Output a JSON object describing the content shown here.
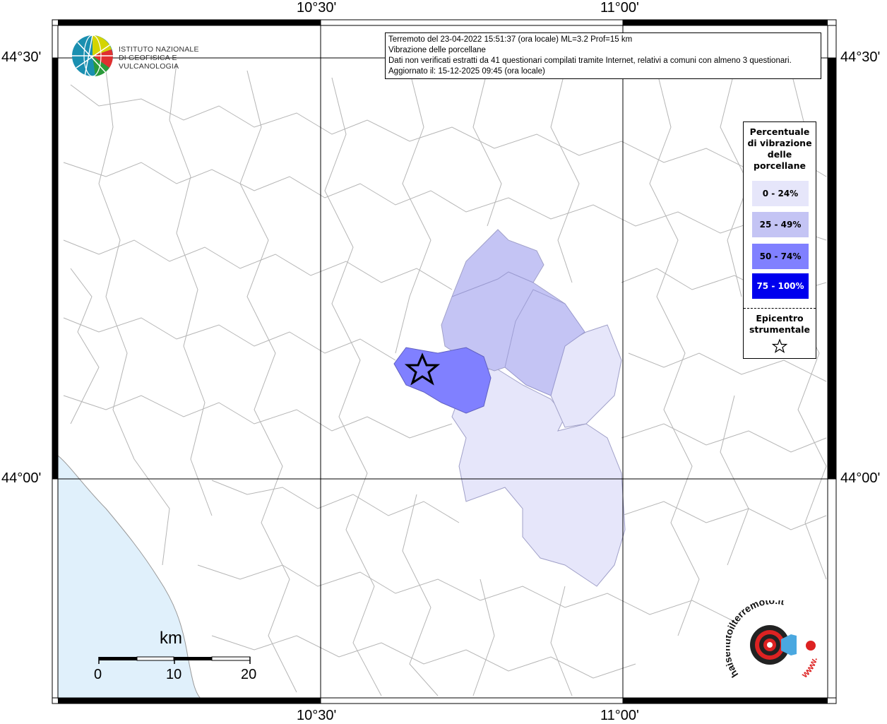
{
  "info": {
    "line1": "Terremoto del 23-04-2022 15:51:37 (ora locale) ML=3.2 Prof=15 km",
    "line2": "Vibrazione delle porcellane",
    "line3": "Dati non verificati estratti da 41 questionari compilati tramite Internet, relativi a comuni con almeno 3 questionari.",
    "line4": "Aggiornato il: 15-12-2025 09:45 (ora locale)"
  },
  "axes": {
    "top_left": "10°30'",
    "top_right": "11°00'",
    "bottom_left": "10°30'",
    "bottom_right": "11°00'",
    "left_top": "44°30'",
    "left_bottom": "44°00'",
    "right_top": "44°30'",
    "right_bottom": "44°00'"
  },
  "logo": {
    "line1": "ISTITUTO NAZIONALE",
    "line2": "DI GEOFISICA E VULCANOLOGIA"
  },
  "legend": {
    "title_lines": [
      "Percentuale",
      "di vibrazione",
      "delle",
      "porcellane"
    ],
    "items": [
      {
        "label": "0 - 24%",
        "color": "#e6e6fa",
        "text_color": "#000000"
      },
      {
        "label": "25 - 49%",
        "color": "#c4c4f4",
        "text_color": "#000000"
      },
      {
        "label": "50 - 74%",
        "color": "#8080ff",
        "text_color": "#000000"
      },
      {
        "label": "75 - 100%",
        "color": "#0000ee",
        "text_color": "#ffffff"
      }
    ],
    "epicenter_lines": [
      "Epicentro",
      "strumentale"
    ]
  },
  "scale": {
    "unit": "km",
    "ticks": [
      "0",
      "10",
      "20"
    ]
  },
  "colors": {
    "sea": "#e0f0fb",
    "border_lines": "#b5b5b5",
    "grid": "#000000"
  },
  "hsl_logo": {
    "text": "haisentitoilterremoto.it",
    "www": "www."
  }
}
